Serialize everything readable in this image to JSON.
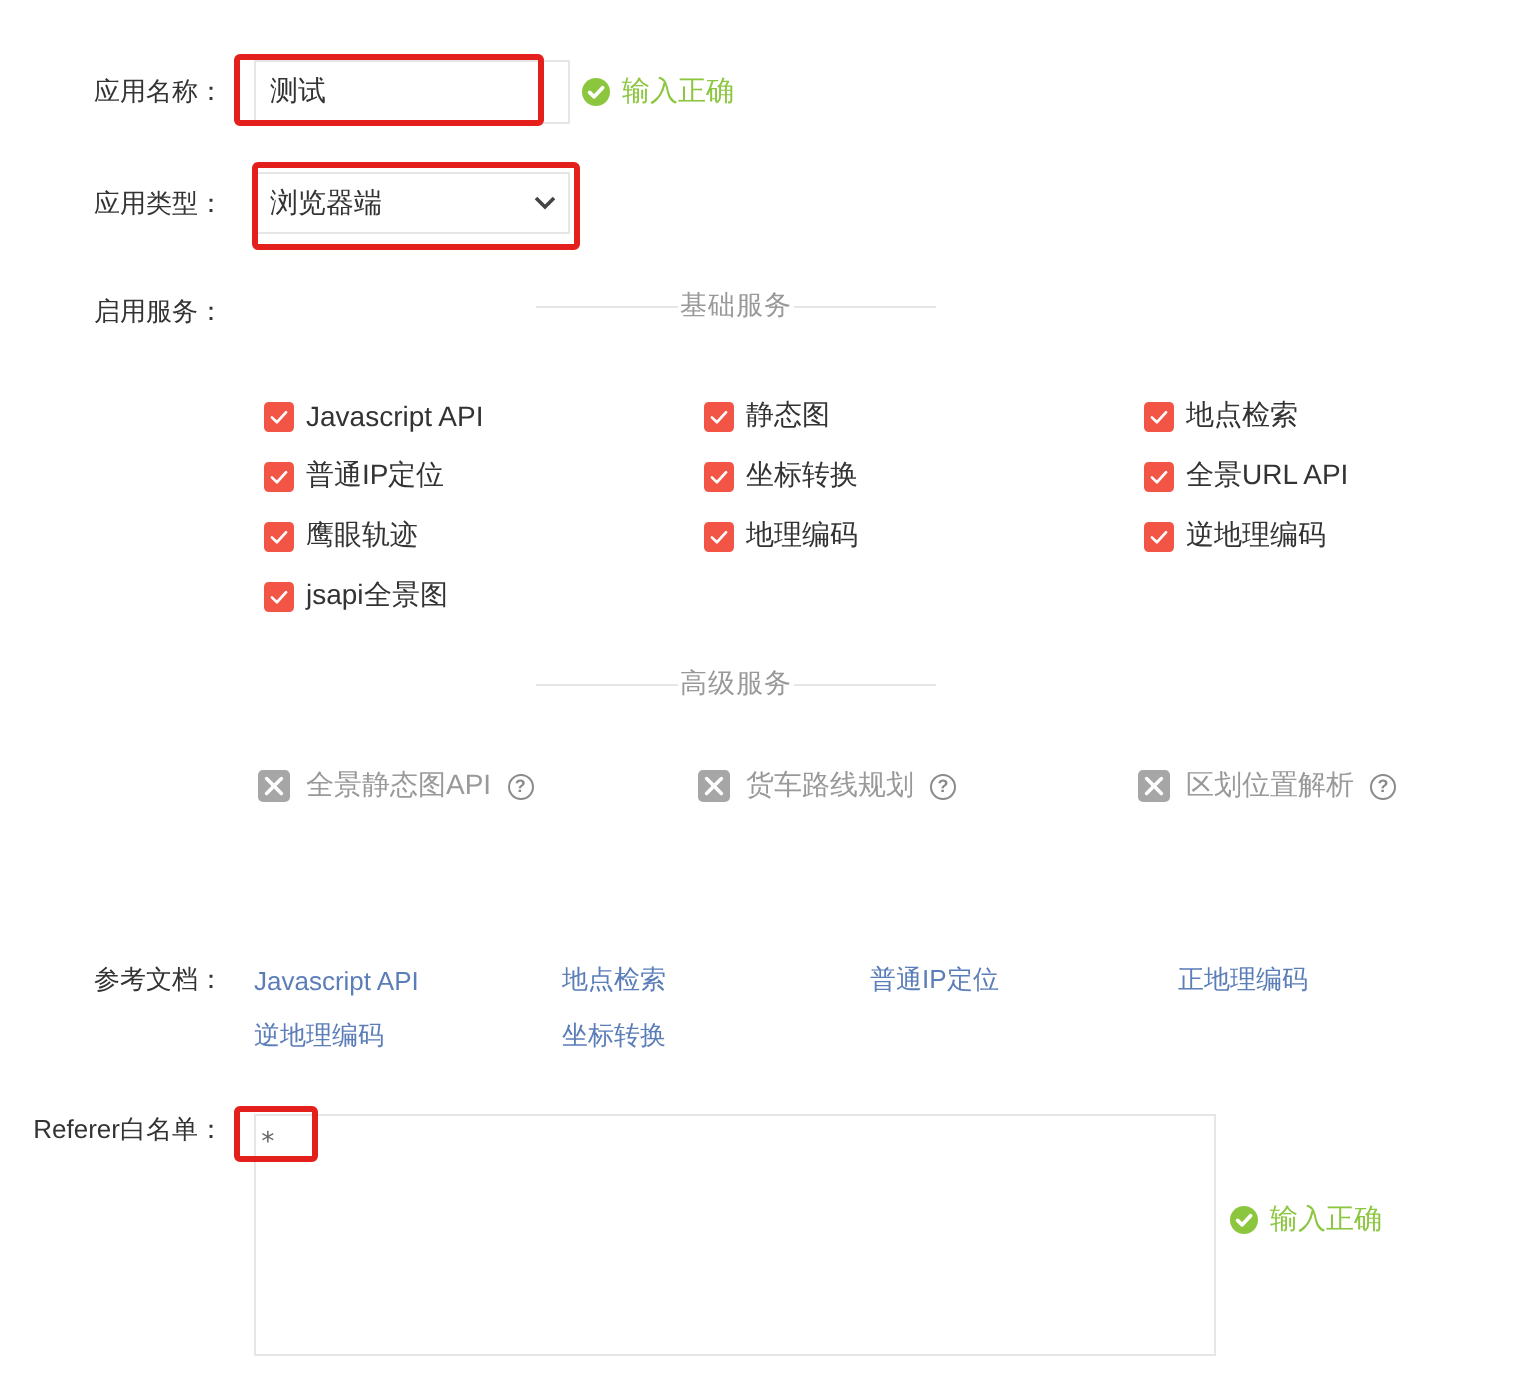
{
  "name_field": {
    "label": "应用名称：",
    "value": "测试",
    "highlighted": true,
    "status": {
      "text": "输入正确",
      "valid": true
    }
  },
  "type_field": {
    "label": "应用类型：",
    "value": "浏览器端",
    "highlighted": true
  },
  "services": {
    "label": "启用服务：",
    "groups": [
      {
        "title": "基础服务",
        "items": [
          {
            "label": "Javascript API",
            "checked": true,
            "disabled": false
          },
          {
            "label": "静态图",
            "checked": true,
            "disabled": false
          },
          {
            "label": "地点检索",
            "checked": true,
            "disabled": false
          },
          {
            "label": "普通IP定位",
            "checked": true,
            "disabled": false
          },
          {
            "label": "坐标转换",
            "checked": true,
            "disabled": false
          },
          {
            "label": "全景URL API",
            "checked": true,
            "disabled": false
          },
          {
            "label": "鹰眼轨迹",
            "checked": true,
            "disabled": false
          },
          {
            "label": "地理编码",
            "checked": true,
            "disabled": false
          },
          {
            "label": "逆地理编码",
            "checked": true,
            "disabled": false
          },
          {
            "label": "jsapi全景图",
            "checked": true,
            "disabled": false
          }
        ]
      },
      {
        "title": "高级服务",
        "items": [
          {
            "label": "全景静态图API",
            "checked": false,
            "disabled": true,
            "help": "?"
          },
          {
            "label": "货车路线规划",
            "checked": false,
            "disabled": true,
            "help": "?"
          },
          {
            "label": "区划位置解析",
            "checked": false,
            "disabled": true,
            "help": "?"
          }
        ]
      }
    ]
  },
  "docs": {
    "label": "参考文档：",
    "links": [
      "Javascript API",
      "地点检索",
      "普通IP定位",
      "正地理编码",
      "逆地理编码",
      "坐标转换"
    ]
  },
  "referer": {
    "label": "Referer白名单：",
    "value": "*",
    "highlighted": true,
    "status": {
      "text": "输入正确",
      "valid": true
    }
  }
}
